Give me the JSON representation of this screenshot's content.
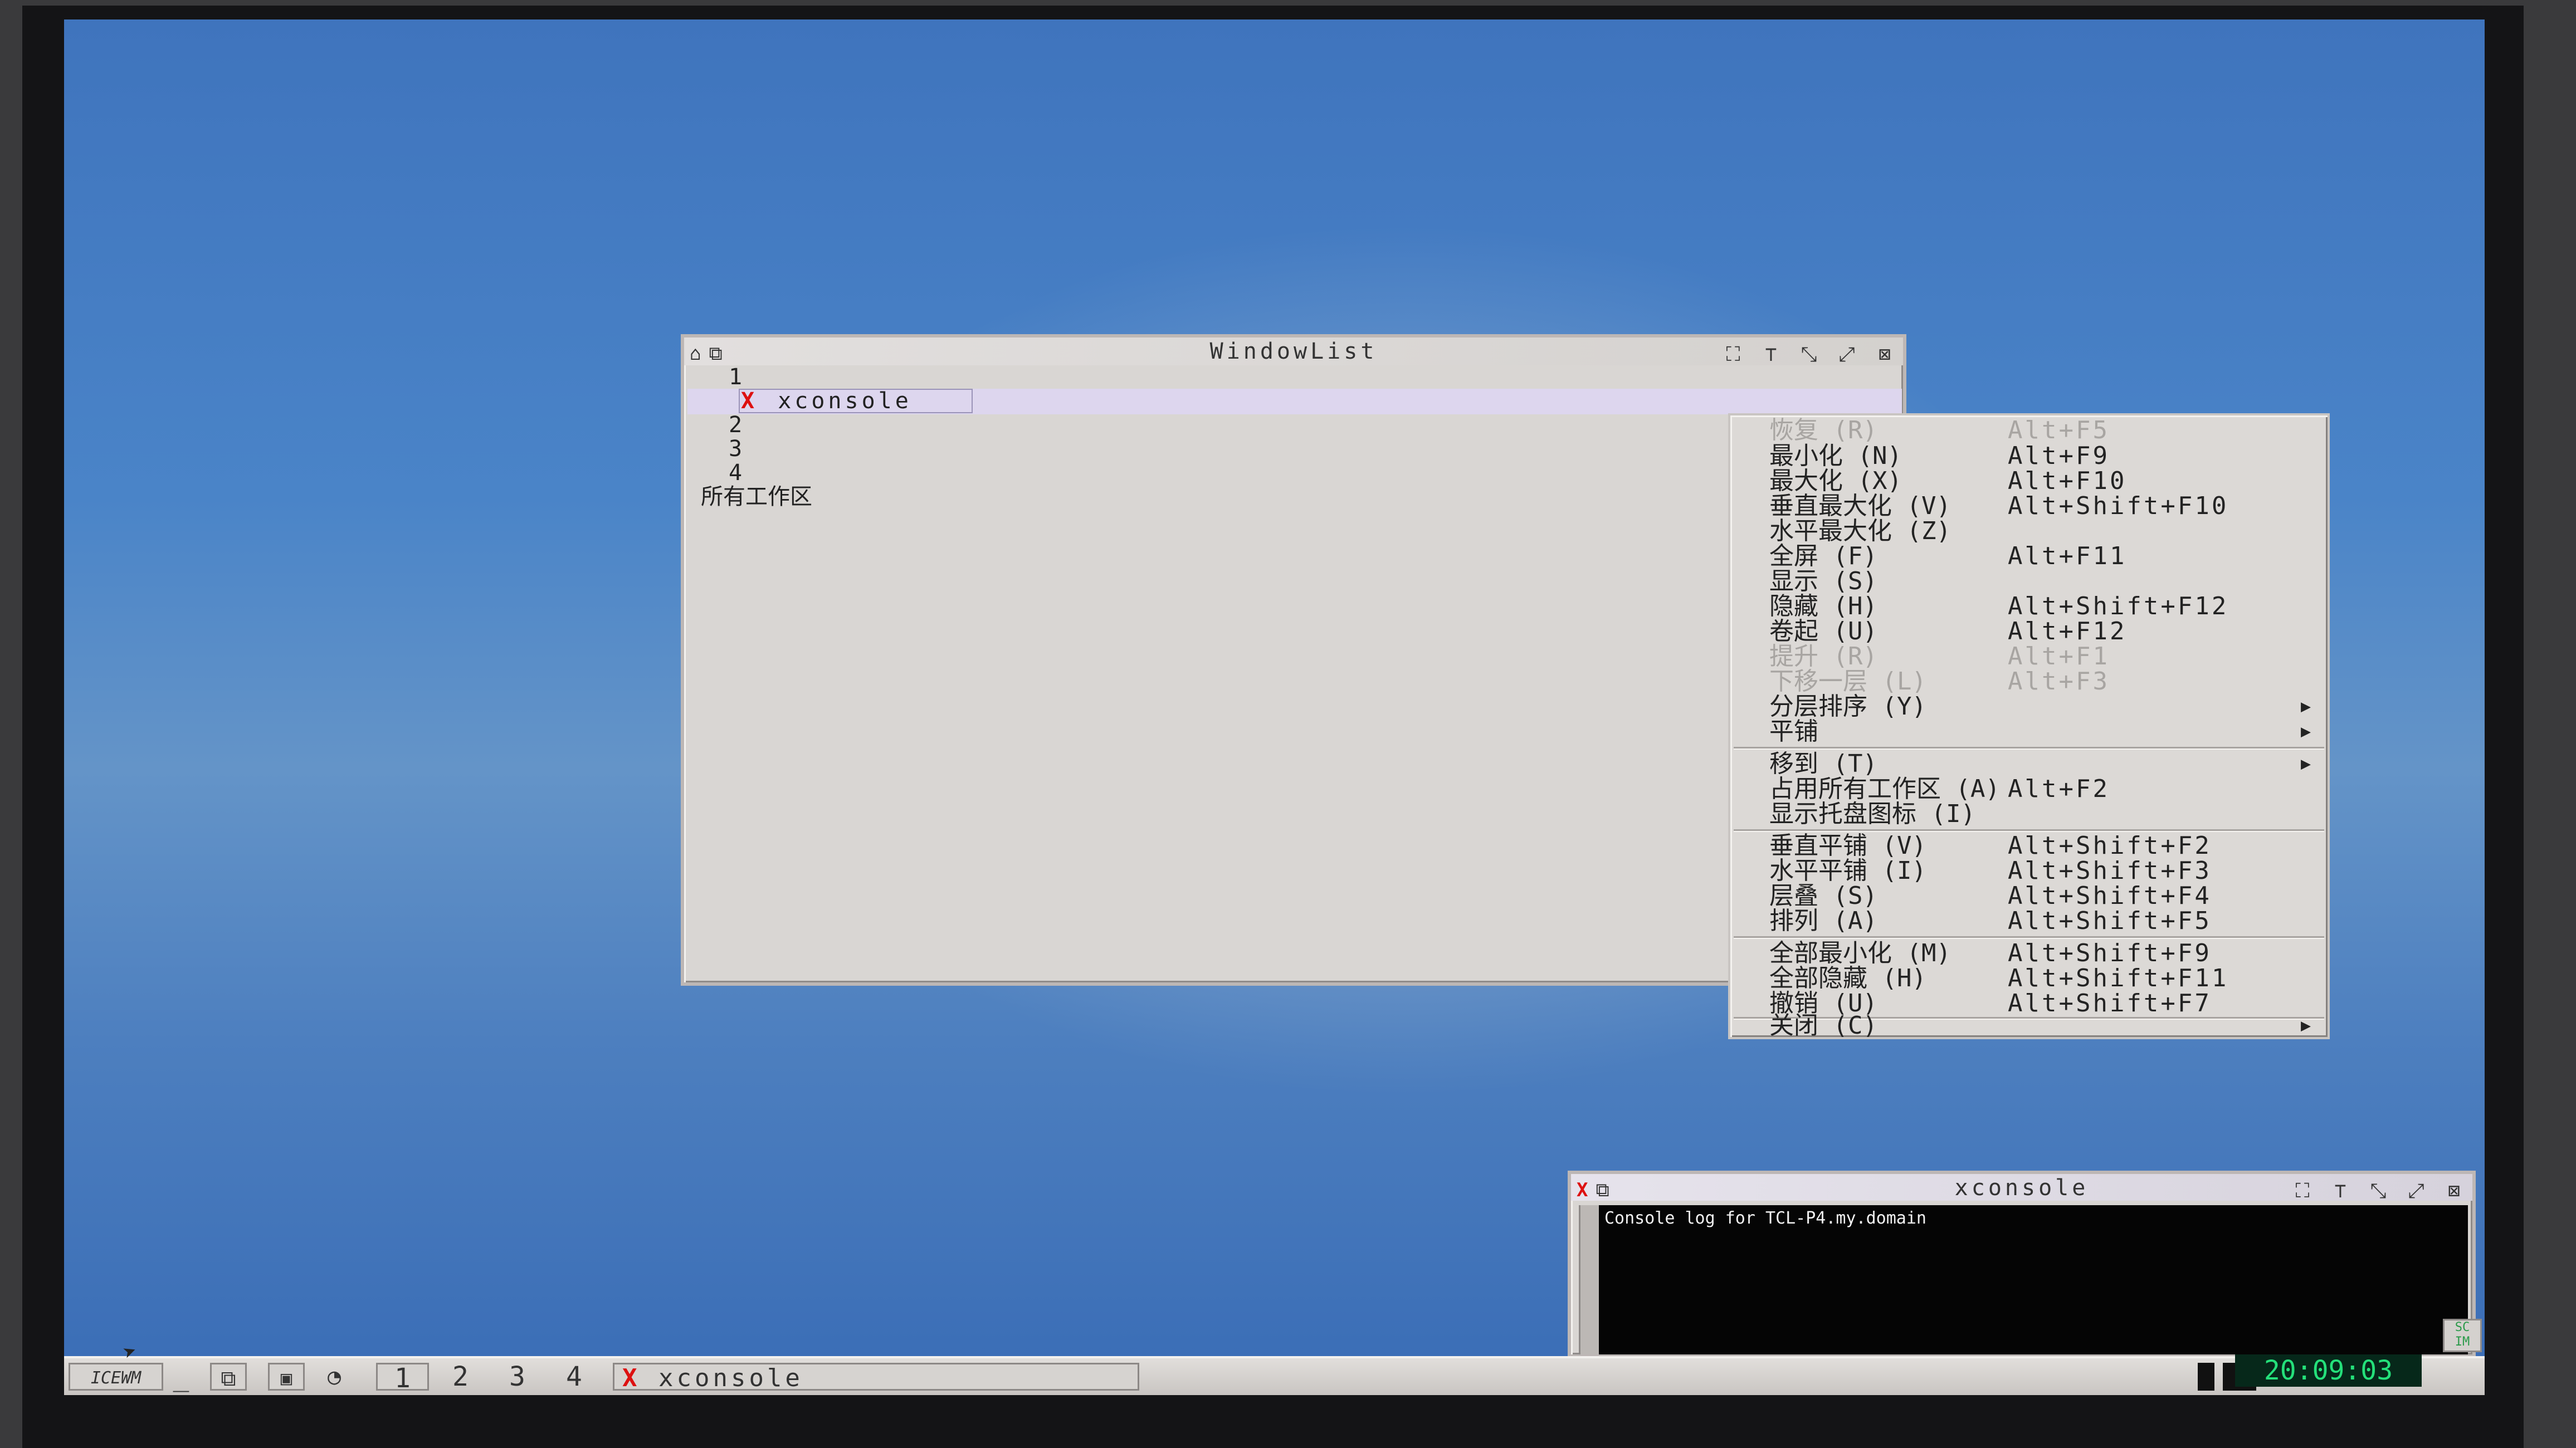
{
  "windowlist": {
    "title": "WindowList",
    "rows": [
      "1",
      "xconsole",
      "2",
      "3",
      "4",
      "所有工作区"
    ]
  },
  "menu": {
    "items": [
      {
        "label": "恢复 (R)",
        "accel": "Alt+F5",
        "disabled": true
      },
      {
        "label": "最小化 (N)",
        "accel": "Alt+F9"
      },
      {
        "label": "最大化 (X)",
        "accel": "Alt+F10"
      },
      {
        "label": "垂直最大化 (V)",
        "accel": "Alt+Shift+F10"
      },
      {
        "label": "水平最大化 (Z)",
        "accel": ""
      },
      {
        "label": "全屏 (F)",
        "accel": "Alt+F11"
      },
      {
        "label": "显示 (S)",
        "accel": ""
      },
      {
        "label": "隐藏 (H)",
        "accel": "Alt+Shift+F12"
      },
      {
        "label": "卷起 (U)",
        "accel": "Alt+F12"
      },
      {
        "label": "提升 (R)",
        "accel": "Alt+F1",
        "disabled": true
      },
      {
        "label": "下移一层 (L)",
        "accel": "Alt+F3",
        "disabled": true
      },
      {
        "label": "分层排序 (Y)",
        "accel": "",
        "submenu": true
      },
      {
        "label": "平铺",
        "accel": "",
        "submenu": true
      },
      {
        "label": "移到 (T)",
        "accel": "",
        "submenu": true
      },
      {
        "label": "占用所有工作区 (A)",
        "accel": "Alt+F2"
      },
      {
        "label": "显示托盘图标 (I)",
        "accel": ""
      },
      {
        "label": "垂直平铺 (V)",
        "accel": "Alt+Shift+F2"
      },
      {
        "label": "水平平铺 (I)",
        "accel": "Alt+Shift+F3"
      },
      {
        "label": "层叠 (S)",
        "accel": "Alt+Shift+F4"
      },
      {
        "label": "排列 (A)",
        "accel": "Alt+Shift+F5"
      },
      {
        "label": "全部最小化 (M)",
        "accel": "Alt+Shift+F9"
      },
      {
        "label": "全部隐藏 (H)",
        "accel": "Alt+Shift+F11"
      },
      {
        "label": "撤销 (U)",
        "accel": "Alt+Shift+F7"
      },
      {
        "label": "关闭 (C)",
        "accel": "",
        "submenu": true
      }
    ]
  },
  "xconsole": {
    "title": "xconsole",
    "log": "Console log for TCL-P4.my.domain"
  },
  "taskbar": {
    "workspaces": [
      "1",
      "2",
      "3",
      "4"
    ],
    "task_label": "xconsole",
    "clock": "20:09:03",
    "tray_text": "SC IM"
  },
  "colors": {
    "desktop": "#4a84c8",
    "clock_text": "#24e07a",
    "xmark": "#dd1111"
  },
  "icons": [
    "start-menu-icon",
    "show-desktop-icon",
    "window-list-icon",
    "terminal-icon",
    "cpu-monitor-icon",
    "mail-icon",
    "maximize-icon",
    "layer-icon",
    "minimize-icon",
    "restore-icon",
    "close-icon",
    "x-app-icon"
  ]
}
